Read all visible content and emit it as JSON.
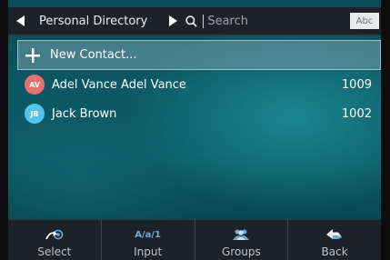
{
  "header": {
    "title": "Personal Directory",
    "search_placeholder": "Search",
    "input_mode": "Abc"
  },
  "new_contact": {
    "label": "New Contact..."
  },
  "contacts": [
    {
      "initials": "AV",
      "name": "Adel Vance Adel Vance",
      "number": "1009",
      "color": "#e8706f"
    },
    {
      "initials": "JB",
      "name": "Jack Brown",
      "number": "1002",
      "color": "#55c3ea"
    }
  ],
  "softkeys": [
    {
      "label": "Select",
      "icon": "select-arrow-icon"
    },
    {
      "label": "Input",
      "icon_text": "A/a/1"
    },
    {
      "label": "Groups",
      "icon": "groups-icon"
    },
    {
      "label": "Back",
      "icon": "back-arrow-icon"
    }
  ],
  "colors": {
    "header_bg": "#1c2227",
    "accent_blue": "#6fa9d6"
  }
}
